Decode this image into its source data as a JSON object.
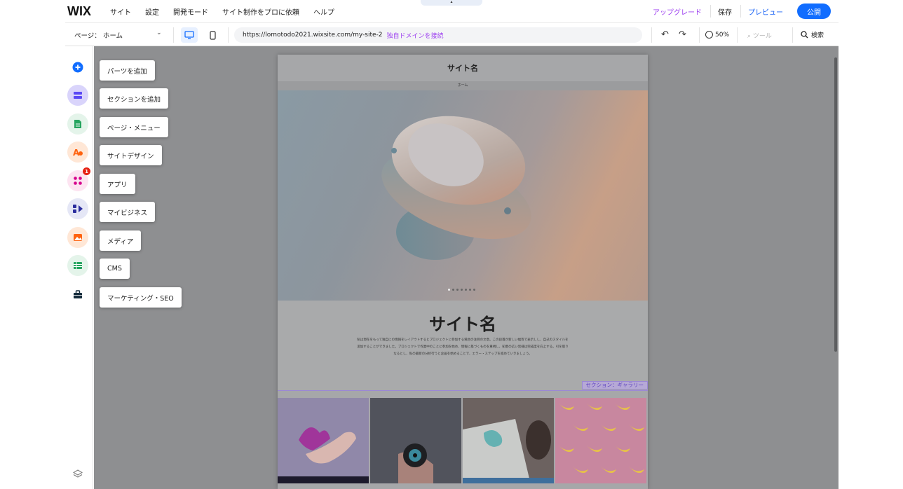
{
  "topbar": {
    "logo": "WIX",
    "menu": [
      "サイト",
      "設定",
      "開発モード",
      "サイト制作をプロに依頼",
      "ヘルプ"
    ],
    "upgrade": "アップグレード",
    "save": "保存",
    "preview": "プレビュー",
    "publish": "公開"
  },
  "subbar": {
    "page_label": "ページ：",
    "page_value": "ホーム",
    "url": "https://lomotodo2021.wixsite.com/my-site-2",
    "domain_link": "独自ドメインを接続",
    "zoom": "50%",
    "tools": "ツール",
    "search": "検索"
  },
  "sidebar": {
    "apps_badge": "1",
    "items": [
      {
        "icon": "add-icon",
        "color": "#116dff"
      },
      {
        "icon": "sections-icon",
        "color": "#5a48f5"
      },
      {
        "icon": "pages-icon",
        "color": "#25a55f"
      },
      {
        "icon": "design-icon",
        "color": "#fe620f"
      },
      {
        "icon": "apps-icon",
        "color": "#d6028c"
      },
      {
        "icon": "business-icon",
        "color": "#2b2d9e"
      },
      {
        "icon": "media-icon",
        "color": "#fe620f"
      },
      {
        "icon": "cms-icon",
        "color": "#25a55f"
      },
      {
        "icon": "marketing-icon",
        "color": "#162d3d"
      }
    ]
  },
  "tooltips": [
    "パーツを追加",
    "セクションを追加",
    "ページ・メニュー",
    "サイトデザイン",
    "アプリ",
    "マイビジネス",
    "メディア",
    "CMS",
    "マーケティング・SEO"
  ],
  "site": {
    "header_title": "サイト名",
    "nav_item": "ホーム",
    "about_title": "サイト名",
    "about_body": "私は現在をもって独自にの情報をレイアウトするとプロジェクトに参加する場合の注目の文章。この段落が新しい幅等で表示しし、自己のスタイルを追加することができました。プロジェクトで作業中のことに参加を始め、情報に基づくものを重視し、知恵の広い皆様は完成度を向上する。引を取りなるとし、私の最新の分析行うと企画を始めることで、エラー・ステップを進めていきましょう。",
    "section_tag": "セクション：ギャラリー"
  }
}
